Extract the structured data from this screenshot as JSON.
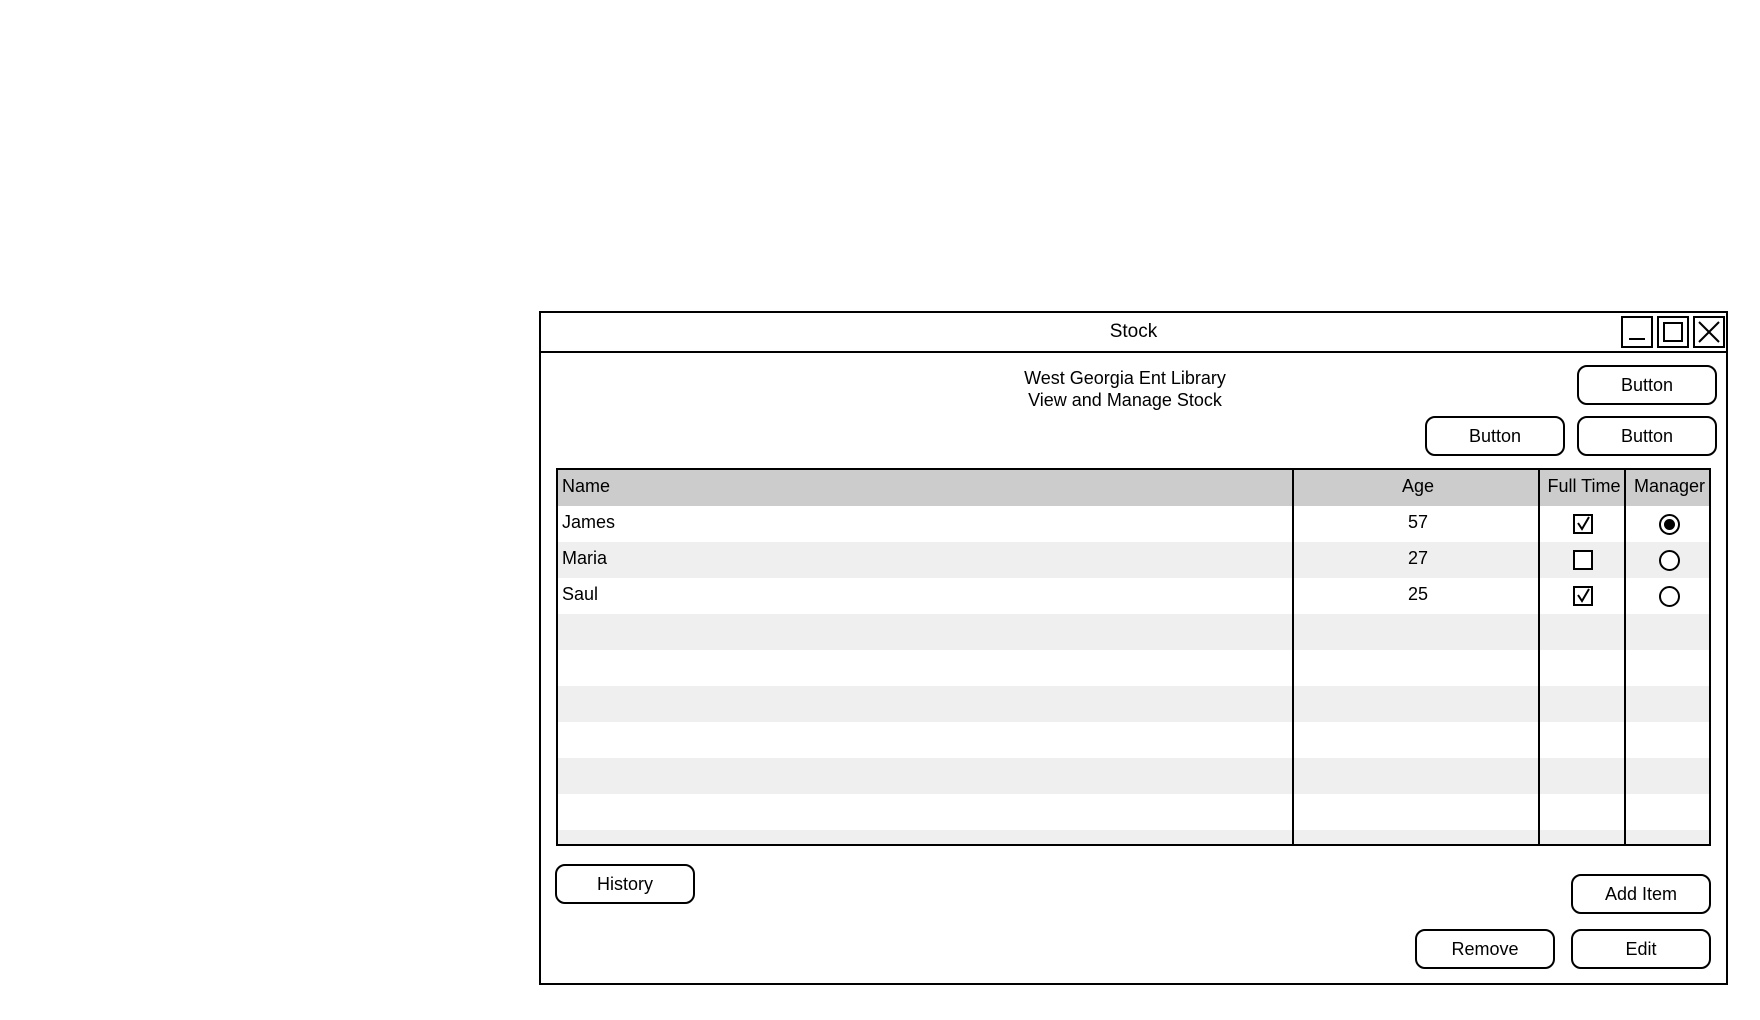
{
  "window": {
    "title": "Stock"
  },
  "header": {
    "line1": "West Georgia Ent Library",
    "line2": "View and Manage Stock"
  },
  "top_buttons": {
    "top_right": "Button",
    "second_left": "Button",
    "second_right": "Button"
  },
  "table": {
    "columns": [
      "Name",
      "Age",
      "Full Time",
      "Manager"
    ],
    "rows": [
      {
        "name": "James",
        "age": "57",
        "full_time": true,
        "manager": true
      },
      {
        "name": "Maria",
        "age": "27",
        "full_time": false,
        "manager": false
      },
      {
        "name": "Saul",
        "age": "25",
        "full_time": true,
        "manager": false
      }
    ],
    "empty_rows": 7
  },
  "bottom_buttons": {
    "history": "History",
    "add_item": "Add Item",
    "remove": "Remove",
    "edit": "Edit"
  },
  "icons": {
    "minimize": "minimize-icon",
    "maximize": "maximize-icon",
    "close": "close-icon"
  }
}
